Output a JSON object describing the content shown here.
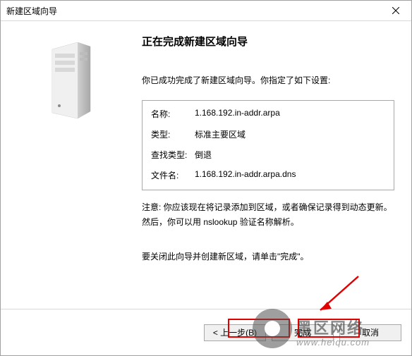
{
  "window": {
    "title": "新建区域向导"
  },
  "heading": "正在完成新建区域向导",
  "intro": "你已成功完成了新建区域向导。你指定了如下设置:",
  "settings": [
    {
      "label": "名称:",
      "value": "1.168.192.in-addr.arpa"
    },
    {
      "label": "类型:",
      "value": "标准主要区域"
    },
    {
      "label": "查找类型:",
      "value": "倒退"
    },
    {
      "label": "文件名:",
      "value": "1.168.192.in-addr.arpa.dns"
    }
  ],
  "note": "注意: 你应该现在将记录添加到区域，或者确保记录得到动态更新。然后，你可以用 nslookup 验证名称解析。",
  "closing": "要关闭此向导并创建新区域，请单击\"完成\"。",
  "buttons": {
    "back": "< 上一步(B)",
    "finish": "完成",
    "cancel": "取消"
  },
  "watermark": {
    "line1": "黑区网络",
    "line2": "www.heiqu.com"
  }
}
